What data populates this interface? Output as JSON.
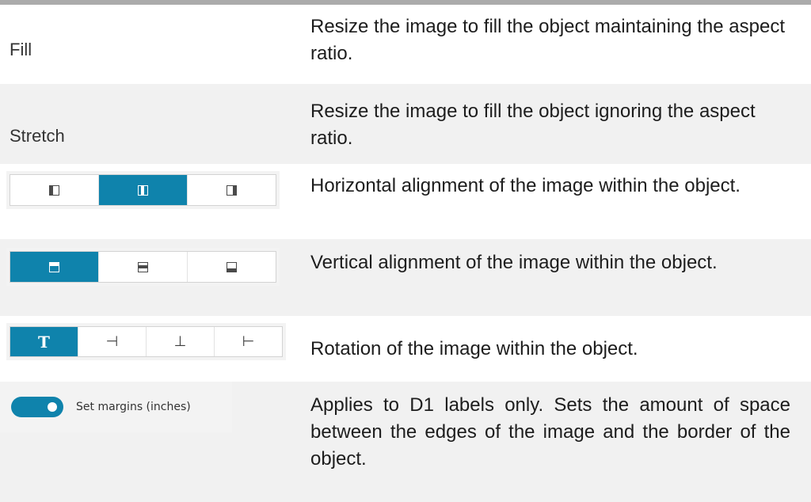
{
  "rows": [
    {
      "label": "Fill",
      "description": "Resize the image to fill the object maintaining the aspect ratio."
    },
    {
      "label": "Stretch",
      "description": "Resize the image to fill the object ignoring the aspect ratio."
    },
    {
      "description": "Horizontal alignment of the image within the object.",
      "control": {
        "type": "segmented",
        "icons": [
          "align-left-icon",
          "align-center-icon",
          "align-right-icon"
        ],
        "selected": 1
      }
    },
    {
      "description": "Vertical alignment of the image within the object.",
      "control": {
        "type": "segmented",
        "icons": [
          "align-top-icon",
          "align-middle-icon",
          "align-bottom-icon"
        ],
        "selected": 0
      }
    },
    {
      "description": "Rotation of the image within the object.",
      "control": {
        "type": "segmented",
        "glyphs": [
          "T",
          "⊣",
          "⊥",
          "⊢"
        ],
        "selected": 0
      }
    },
    {
      "description": "Applies to D1 labels only. Sets the amount of space between the edges of the image and the border of the object.",
      "control": {
        "type": "toggle",
        "label": "Set margins (inches)",
        "on": true
      }
    }
  ],
  "colors": {
    "accent": "#0f83ac",
    "row_alt": "#f1f1f1",
    "top_rule": "#ababab"
  }
}
